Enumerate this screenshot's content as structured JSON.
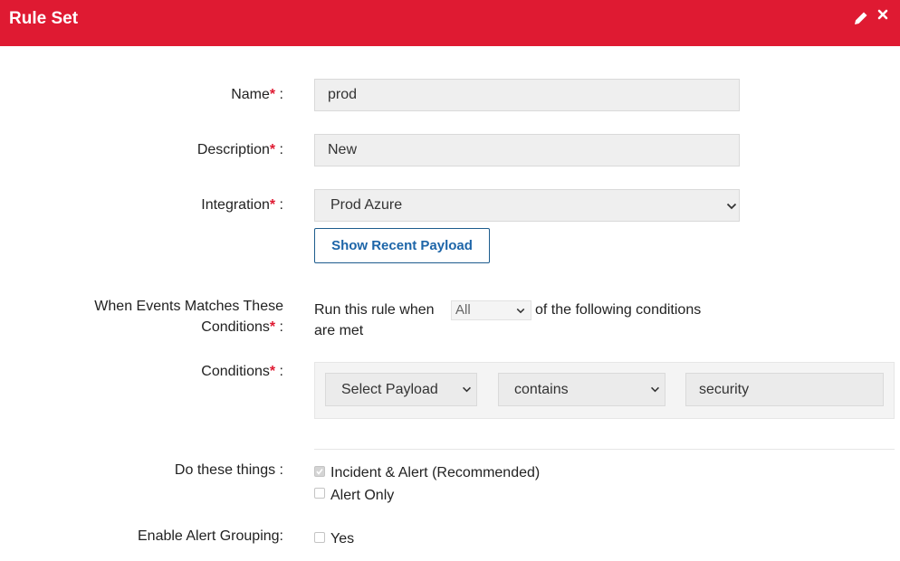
{
  "header": {
    "title": "Rule Set",
    "background": "#df1a32",
    "edit_icon": "pencil-icon",
    "close_icon": "close-icon"
  },
  "form": {
    "name": {
      "label": "Name",
      "value": "prod"
    },
    "description": {
      "label": "Description",
      "value": "New"
    },
    "integration": {
      "label": "Integration",
      "value": "Prod Azure"
    },
    "show_payload_button": "Show Recent Payload",
    "when_events": {
      "label_line1": "When Events Matches These",
      "label_line2": "Conditions",
      "prefix": "Run this rule when",
      "match_select": "All",
      "suffix": "of the following conditions",
      "suffix_line2": "are met"
    },
    "conditions": {
      "label": "Conditions",
      "payload_select": "Select Payload",
      "operator_select": "contains",
      "value": "security"
    },
    "actions": {
      "label": "Do these things :",
      "options": [
        {
          "label": "Incident & Alert (Recommended)",
          "checked": true
        },
        {
          "label": "Alert Only",
          "checked": false
        }
      ]
    },
    "alert_grouping": {
      "label": "Enable Alert Grouping:",
      "option": "Yes",
      "checked": false
    },
    "required_mark": "*",
    "label_suffix": " :"
  }
}
